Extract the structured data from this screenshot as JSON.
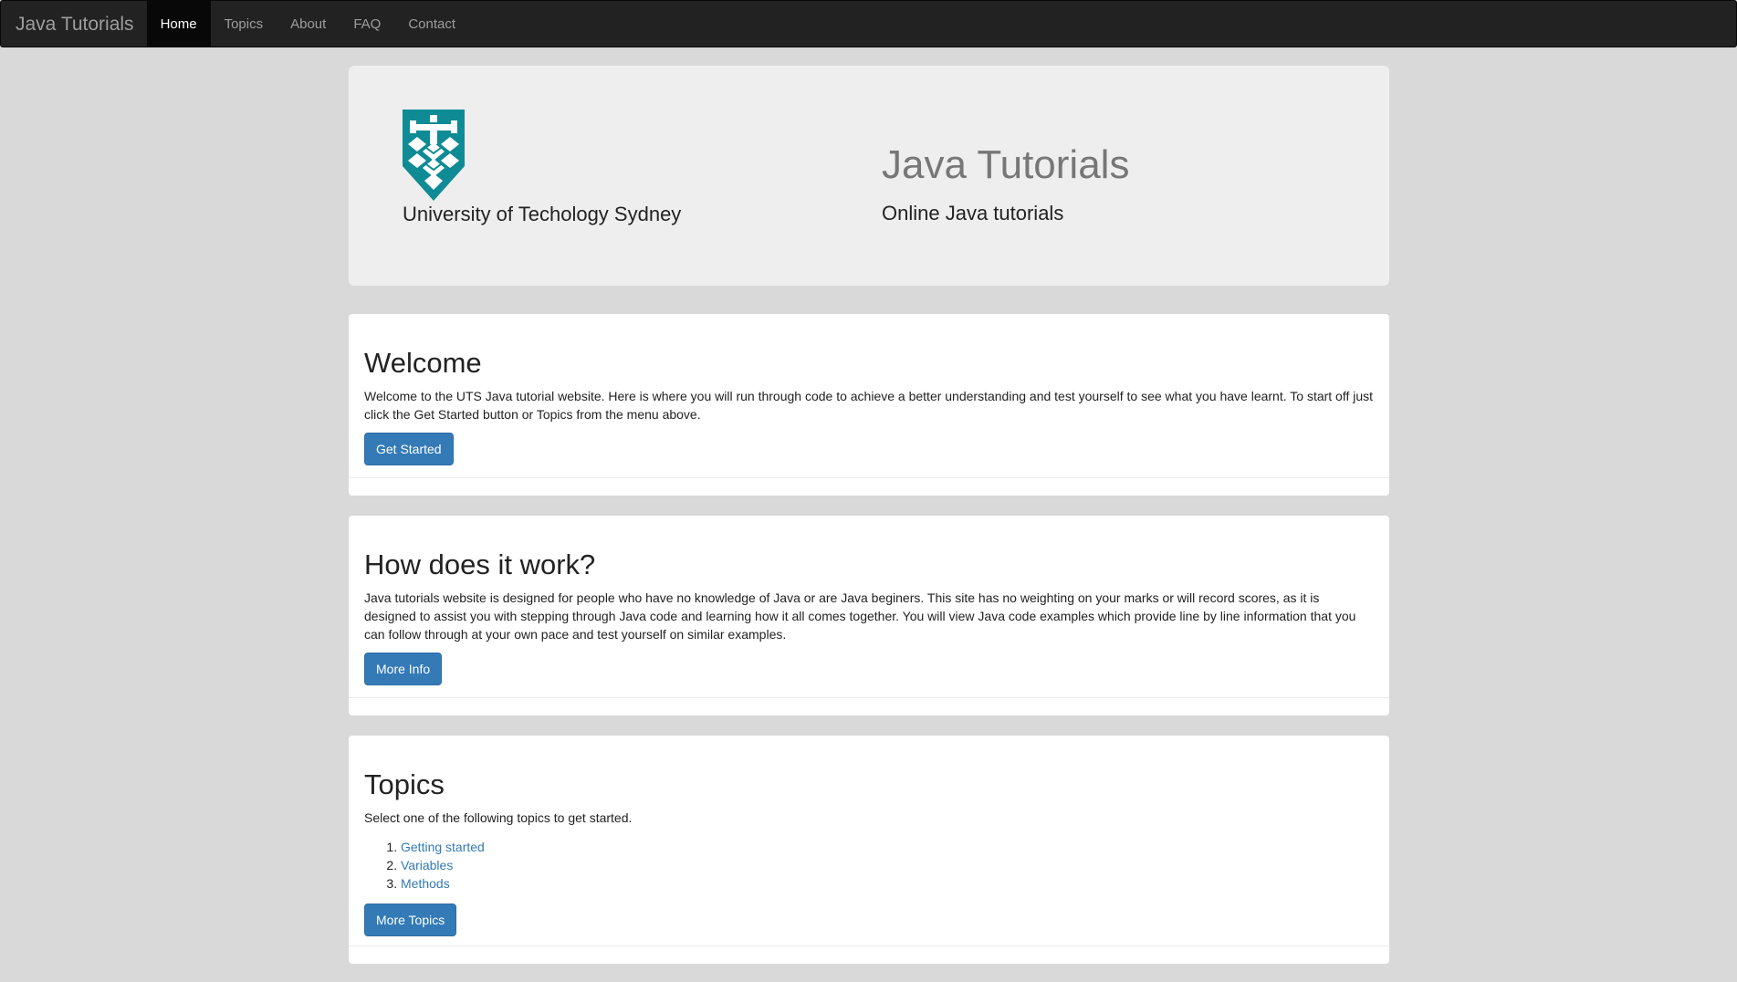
{
  "navbar": {
    "brand": "Java Tutorials",
    "items": [
      {
        "label": "Home",
        "active": true
      },
      {
        "label": "Topics",
        "active": false
      },
      {
        "label": "About",
        "active": false
      },
      {
        "label": "FAQ",
        "active": false
      },
      {
        "label": "Contact",
        "active": false
      }
    ]
  },
  "jumbotron": {
    "university_name": "University of Techology Sydney",
    "title": "Java Tutorials",
    "subtitle": "Online Java tutorials",
    "logo_color": "#0e8b95"
  },
  "welcome": {
    "heading": "Welcome",
    "text": "Welcome to the UTS Java tutorial website. Here is where you will run through code to achieve a better understanding and test yourself to see what you have learnt. To start off just click the Get Started button or Topics from the menu above.",
    "button": "Get Started"
  },
  "how": {
    "heading": "How does it work?",
    "text": "Java tutorials website is designed for people who have no knowledge of Java or are Java beginers. This site has no weighting on your marks or will record scores, as it is designed to assist you with stepping through Java code and learning how it all comes together. You will view Java code examples which provide line by line information that you can follow through at your own pace and test yourself on similar examples.",
    "button": "More Info"
  },
  "topics": {
    "heading": "Topics",
    "text": "Select one of the following topics to get started.",
    "items": [
      "Getting started",
      "Variables",
      "Methods"
    ],
    "button": "More Topics"
  },
  "colors": {
    "primary": "#337ab7",
    "navbar_bg": "#222222",
    "page_bg": "#d9d9d9"
  }
}
